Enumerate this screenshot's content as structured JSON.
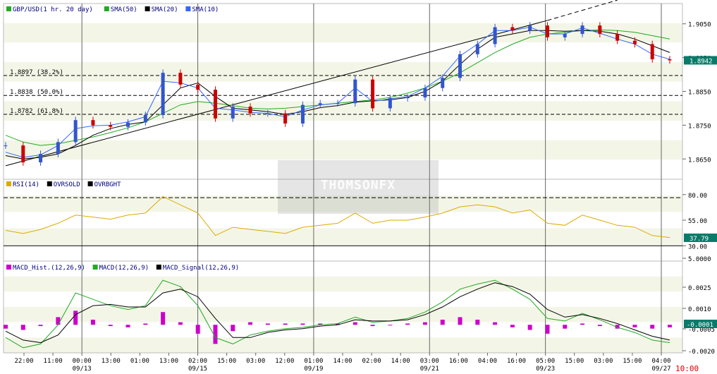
{
  "panels": {
    "price": {
      "legend": [
        {
          "label": "GBP/USD(1 hr.  20 day)",
          "color": "#22aa22"
        },
        {
          "label": "SMA(50)",
          "color": "#22aa22"
        },
        {
          "label": "SMA(20)",
          "color": "#000000"
        },
        {
          "label": "SMA(10)",
          "color": "#3366ff"
        }
      ],
      "yticks": [
        "1.9050",
        "1.8950",
        "1.8850",
        "1.8750",
        "1.8650"
      ],
      "current_value": "1.8942",
      "fib_levels": [
        {
          "label": "1.8897 (38.2%)",
          "value": 1.8897
        },
        {
          "label": "1.8838 (50.0%)",
          "value": 1.8838
        },
        {
          "label": "1.8782 (61.8%)",
          "value": 1.8782
        }
      ]
    },
    "rsi": {
      "legend": [
        {
          "label": "RSI(14)",
          "color": "#ddaa00"
        },
        {
          "label": "OVRSOLD",
          "color": "#000000"
        },
        {
          "label": "OVRBGHT",
          "color": "#000000"
        }
      ],
      "yticks": [
        "80.00",
        "55.00",
        "30.00"
      ],
      "current_value": "37.79"
    },
    "macd": {
      "legend": [
        {
          "label": "MACD_Hist.(12,26,9)",
          "color": "#cc00cc"
        },
        {
          "label": "MACD(12,26,9)",
          "color": "#22aa22"
        },
        {
          "label": "MACD_Signal(12,26,9)",
          "color": "#000000"
        }
      ],
      "yticks": [
        "5.0000",
        "0.0025",
        "0.0010",
        "-0.0005",
        "-0.0020"
      ],
      "current_value": "-0.0001"
    }
  },
  "watermark": "THOMSONFX",
  "time_readout": "10:00",
  "chart_data": {
    "type": "line",
    "x_time_labels": [
      "22:00",
      "11:00",
      "00:00",
      "13:00",
      "01:00",
      "13:00",
      "02:00",
      "15:00",
      "03:00",
      "12:00",
      "01:00",
      "14:00",
      "02:00",
      "14:00",
      "03:00",
      "16:00",
      "04:00",
      "16:00",
      "05:00",
      "15:00",
      "03:00",
      "15:00",
      "04:00"
    ],
    "x_date_labels": [
      {
        "label": "09/13",
        "index": 2
      },
      {
        "label": "09/15",
        "index": 6
      },
      {
        "label": "09/19",
        "index": 10
      },
      {
        "label": "09/21",
        "index": 14
      },
      {
        "label": "09/23",
        "index": 18
      },
      {
        "label": "09/27",
        "index": 22
      }
    ],
    "series": [
      {
        "name": "GBP/USD",
        "color": "#cc0000",
        "values": [
          1.869,
          1.864,
          1.8665,
          1.87,
          1.8765,
          1.875,
          1.8745,
          1.8758,
          1.878,
          1.8905,
          1.887,
          1.8855,
          1.877,
          1.8805,
          1.8785,
          1.8785,
          1.8755,
          1.881,
          1.8815,
          1.8815,
          1.8885,
          1.88,
          1.883,
          1.8832,
          1.886,
          1.889,
          1.896,
          1.899,
          1.904,
          1.903,
          1.9045,
          1.901,
          1.902,
          1.9045,
          1.902,
          1.9,
          1.899,
          1.8945,
          1.8942
        ]
      },
      {
        "name": "SMA(50)",
        "color": "#22aa22",
        "values": [
          1.872,
          1.87,
          1.869,
          1.8695,
          1.8705,
          1.8715,
          1.8728,
          1.8742,
          1.876,
          1.8785,
          1.881,
          1.882,
          1.8815,
          1.8808,
          1.88,
          1.8798,
          1.88,
          1.8805,
          1.881,
          1.8815,
          1.882,
          1.8825,
          1.8832,
          1.8845,
          1.886,
          1.888,
          1.8905,
          1.8935,
          1.8965,
          1.899,
          1.901,
          1.902,
          1.9025,
          1.903,
          1.9032,
          1.903,
          1.9025,
          1.9015,
          1.9005
        ]
      },
      {
        "name": "SMA(20)",
        "color": "#000000",
        "values": [
          1.866,
          1.865,
          1.8655,
          1.8665,
          1.869,
          1.872,
          1.874,
          1.8752,
          1.876,
          1.881,
          1.886,
          1.8875,
          1.8835,
          1.88,
          1.8795,
          1.879,
          1.8782,
          1.879,
          1.8802,
          1.8808,
          1.8818,
          1.8822,
          1.8825,
          1.8832,
          1.885,
          1.888,
          1.893,
          1.8975,
          1.901,
          1.902,
          1.903,
          1.903,
          1.9028,
          1.903,
          1.9028,
          1.902,
          1.9005,
          1.8985,
          1.8965
        ]
      },
      {
        "name": "SMA(10)",
        "color": "#3366ff",
        "values": [
          1.867,
          1.8655,
          1.8662,
          1.869,
          1.874,
          1.8748,
          1.875,
          1.876,
          1.8775,
          1.888,
          1.8875,
          1.886,
          1.88,
          1.8795,
          1.8788,
          1.8785,
          1.8775,
          1.8795,
          1.881,
          1.8815,
          1.886,
          1.882,
          1.8828,
          1.8835,
          1.886,
          1.8895,
          1.8955,
          1.899,
          1.903,
          1.903,
          1.904,
          1.902,
          1.902,
          1.9038,
          1.9022,
          1.9005,
          1.899,
          1.896,
          1.8945
        ]
      }
    ],
    "trendlines": [
      {
        "from": [
          0,
          1.863
        ],
        "to": [
          31,
          1.906
        ],
        "style": "solid"
      },
      {
        "from": [
          31,
          1.906
        ],
        "to": [
          35,
          1.912
        ],
        "style": "dashed"
      }
    ],
    "rsi_values": [
      45,
      42,
      46,
      52,
      60,
      58,
      56,
      60,
      62,
      78,
      70,
      62,
      40,
      48,
      46,
      44,
      42,
      48,
      50,
      52,
      62,
      52,
      55,
      55,
      58,
      62,
      68,
      70,
      68,
      62,
      65,
      52,
      50,
      60,
      55,
      50,
      48,
      40,
      38
    ],
    "macd_values": [
      -0.001,
      -0.0018,
      -0.0015,
      0.0,
      0.0025,
      0.002,
      0.0015,
      0.0012,
      0.0015,
      0.0035,
      0.003,
      0.0015,
      -0.001,
      -0.0015,
      -0.0008,
      -0.0005,
      -0.0003,
      -0.0002,
      0.0,
      0.0001,
      0.0006,
      0.0002,
      0.0003,
      0.0005,
      0.001,
      0.0018,
      0.0028,
      0.0032,
      0.0035,
      0.0028,
      0.002,
      0.0005,
      0.0003,
      0.0009,
      0.0004,
      -0.0002,
      -0.0006,
      -0.0012,
      -0.0014
    ],
    "macd_signal_values": [
      -0.0005,
      -0.0012,
      -0.0014,
      -0.0008,
      0.0008,
      0.0015,
      0.0016,
      0.0014,
      0.0014,
      0.0025,
      0.0028,
      0.0022,
      0.0005,
      -0.001,
      -0.001,
      -0.0006,
      -0.0004,
      -0.0003,
      -0.0001,
      0.0,
      0.0004,
      0.0003,
      0.0003,
      0.0004,
      0.0008,
      0.0014,
      0.0022,
      0.0028,
      0.0033,
      0.003,
      0.0024,
      0.0012,
      0.0006,
      0.0008,
      0.0005,
      0.0001,
      -0.0004,
      -0.0009,
      -0.0012
    ],
    "macd_hist_values": [
      -0.0003,
      -0.0004,
      -0.0001,
      0.0006,
      0.0011,
      0.0004,
      -0.0001,
      -0.0002,
      0.0001,
      0.001,
      0.0002,
      -0.0007,
      -0.0015,
      -0.0005,
      0.0002,
      0.0001,
      0.0001,
      0.0001,
      0.0001,
      0.0001,
      0.0002,
      -0.0001,
      0.0,
      0.0001,
      0.0002,
      0.0004,
      0.0006,
      0.0004,
      0.0002,
      -0.0002,
      -0.0004,
      -0.0007,
      -0.0003,
      0.0001,
      -0.0001,
      -0.0003,
      -0.0002,
      -0.0003,
      -0.0002
    ],
    "ranges": {
      "price_ylim": [
        1.859,
        1.911
      ],
      "rsi_ylim": [
        15,
        95
      ],
      "macd_ylim": [
        -0.0022,
        0.005
      ]
    }
  }
}
